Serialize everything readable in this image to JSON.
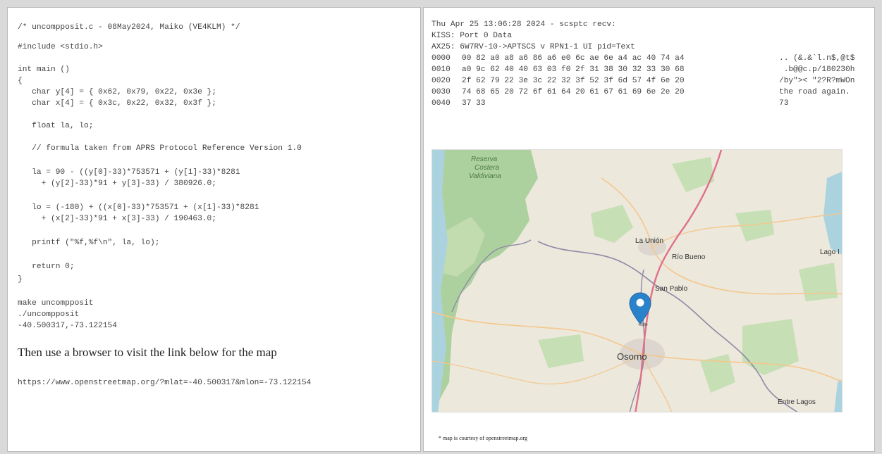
{
  "left": {
    "code_lines": [
      "/* uncompposit.c - 08May2024, Maiko (VE4KLM) */",
      "#include <stdio.h>",
      "int main ()",
      "{",
      "   char y[4] = { 0x62, 0x79, 0x22, 0x3e };",
      "   char x[4] = { 0x3c, 0x22, 0x32, 0x3f };",
      "   float la, lo;",
      "   // formula taken from APRS Protocol Reference Version 1.0",
      "   la = 90 - ((y[0]-33)*753571 + (y[1]-33)*8281",
      "     + (y[2]-33)*91 + y[3]-33) / 380926.0;",
      "   lo = (-180) + ((x[0]-33)*753571 + (x[1]-33)*8281",
      "     + (x[2]-33)*91 + x[3]-33) / 190463.0;",
      "   printf (\"%f,%f\\n\", la, lo);",
      "   return 0;",
      "}",
      "make uncompposit",
      "./uncompposit",
      "-40.500317,-73.122154"
    ],
    "instruction": "Then use a browser to visit the link below for the map",
    "url": "https://www.openstreetmap.org/?mlat=-40.500317&mlon=-73.122154"
  },
  "right": {
    "header_lines": [
      "Thu Apr 25 13:06:28 2024 - scsptc recv:",
      "KISS: Port 0 Data",
      "AX25: 6W7RV-10->APTSCS v RPN1-1 UI pid=Text"
    ],
    "hex_rows": [
      {
        "offset": "0000",
        "bytes": "00 82 a0 a8 a6 86 a6 e0 6c ae 6e a4 ac 40 74 a4",
        "ascii": ".. (&.&`l.n$,@t$"
      },
      {
        "offset": "0010",
        "bytes": "a0 9c 62 40 40 63 03 f0 2f 31 38 30 32 33 30 68",
        "ascii": " .b@@c.p/180230h"
      },
      {
        "offset": "0020",
        "bytes": "2f 62 79 22 3e 3c 22 32 3f 52 3f 6d 57 4f 6e 20",
        "ascii": "/by\">< \"2?R?mWOn "
      },
      {
        "offset": "0030",
        "bytes": "74 68 65 20 72 6f 61 64 20 61 67 61 69 6e 2e 20",
        "ascii": "the road again. "
      },
      {
        "offset": "0040",
        "bytes": "37 33",
        "ascii": "73"
      }
    ],
    "map": {
      "labels": {
        "reserva": "Reserva",
        "costera": "Costera",
        "valdiviana": "Valdiviana",
        "la_union": "La Unión",
        "rio_bueno": "Río Bueno",
        "lago": "Lago I",
        "san_pablo": "San Pablo",
        "osorno": "Osorno",
        "entre_lagos": "Entre Lagos"
      },
      "colors": {
        "land": "#ece8dc",
        "forest": "#add19e",
        "water": "#aad3df",
        "road": "#e892a2",
        "marker": "#2a82cb"
      }
    },
    "caption": "* map is courtesy of openstreetmap.org"
  }
}
